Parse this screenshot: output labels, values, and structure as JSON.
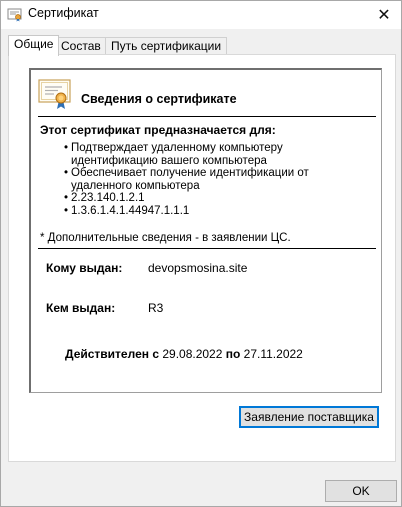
{
  "window": {
    "title": "Сертификат",
    "close_glyph": "✕",
    "icon": "certificate-icon"
  },
  "tabs": [
    {
      "label": "Общие",
      "active": true
    },
    {
      "label": "Состав",
      "active": false
    },
    {
      "label": "Путь сертификации",
      "active": false
    }
  ],
  "general": {
    "header_title": "Сведения о сертификате",
    "header_icon": "certificate-ribbon-icon",
    "purposes_title": "Этот сертификат предназначается для:",
    "purposes": [
      "Подтверждает удаленному компьютеру идентификацию вашего компьютера",
      "Обеспечивает получение идентификации от удаленного компьютера",
      "2.23.140.1.2.1",
      "1.3.6.1.4.1.44947.1.1.1"
    ],
    "footnote": "* Дополнительные сведения - в заявлении ЦС.",
    "issued_to_label": "Кому выдан:",
    "issued_to_value": "devopsmosina.site",
    "issued_by_label": "Кем выдан:",
    "issued_by_value": "R3",
    "valid_from_label": "Действителен с",
    "valid_from": "29.08.2022",
    "valid_to_label": "по",
    "valid_to": "27.11.2022"
  },
  "buttons": {
    "issuer_statement": "Заявление поставщика",
    "ok": "OK"
  }
}
